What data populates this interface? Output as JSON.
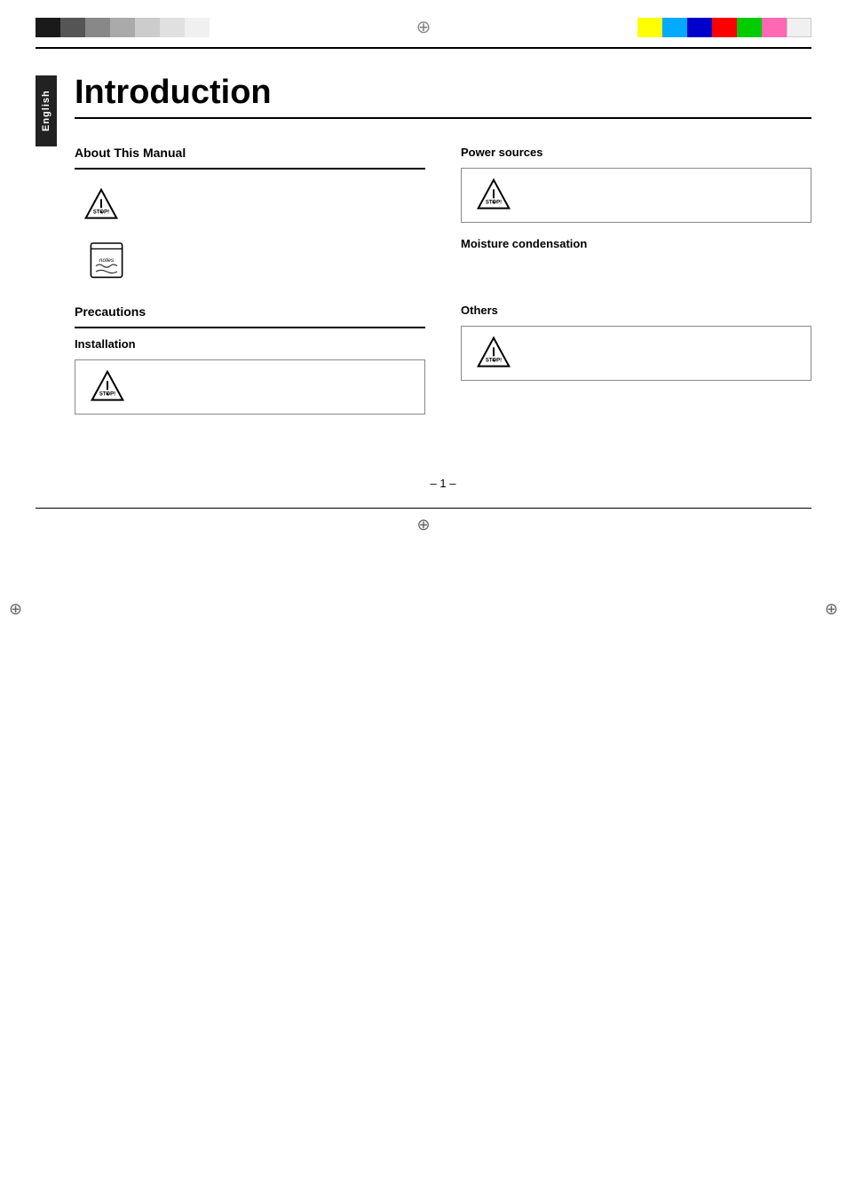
{
  "page": {
    "title": "Introduction",
    "page_number": "– 1 –",
    "lang_tab": "English"
  },
  "top_colors_left": [
    {
      "color": "#1a1a1a"
    },
    {
      "color": "#555555"
    },
    {
      "color": "#888888"
    },
    {
      "color": "#aaaaaa"
    },
    {
      "color": "#cccccc"
    },
    {
      "color": "#e0e0e0"
    },
    {
      "color": "#f0f0f0"
    }
  ],
  "top_colors_right": [
    {
      "color": "#ffff00"
    },
    {
      "color": "#00aaff"
    },
    {
      "color": "#0000cc"
    },
    {
      "color": "#ff0000"
    },
    {
      "color": "#00cc00"
    },
    {
      "color": "#ff69b4"
    },
    {
      "color": "#f0f0f0"
    }
  ],
  "sections": {
    "about_this_manual": {
      "heading": "About This Manual",
      "body": ""
    },
    "stop_icon_label": "STOP warning icon",
    "notes_icon_label": "notes icon",
    "precautions": {
      "heading": "Precautions",
      "sub_heading_installation": "Installation",
      "installation_body": ""
    },
    "power_sources": {
      "heading": "Power sources",
      "body": ""
    },
    "moisture_condensation": {
      "heading": "Moisture condensation",
      "body": ""
    },
    "others": {
      "heading": "Others",
      "body": ""
    }
  }
}
